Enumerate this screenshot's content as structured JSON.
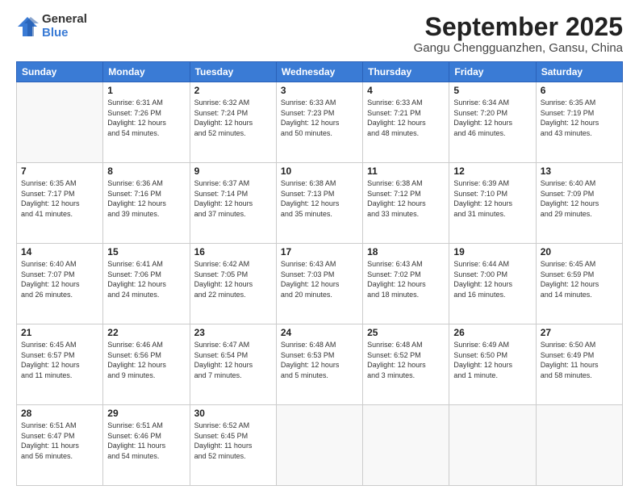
{
  "logo": {
    "general": "General",
    "blue": "Blue"
  },
  "title": "September 2025",
  "location": "Gangu Chengguanzhen, Gansu, China",
  "weekdays": [
    "Sunday",
    "Monday",
    "Tuesday",
    "Wednesday",
    "Thursday",
    "Friday",
    "Saturday"
  ],
  "weeks": [
    [
      {
        "day": "",
        "info": ""
      },
      {
        "day": "1",
        "info": "Sunrise: 6:31 AM\nSunset: 7:26 PM\nDaylight: 12 hours\nand 54 minutes."
      },
      {
        "day": "2",
        "info": "Sunrise: 6:32 AM\nSunset: 7:24 PM\nDaylight: 12 hours\nand 52 minutes."
      },
      {
        "day": "3",
        "info": "Sunrise: 6:33 AM\nSunset: 7:23 PM\nDaylight: 12 hours\nand 50 minutes."
      },
      {
        "day": "4",
        "info": "Sunrise: 6:33 AM\nSunset: 7:21 PM\nDaylight: 12 hours\nand 48 minutes."
      },
      {
        "day": "5",
        "info": "Sunrise: 6:34 AM\nSunset: 7:20 PM\nDaylight: 12 hours\nand 46 minutes."
      },
      {
        "day": "6",
        "info": "Sunrise: 6:35 AM\nSunset: 7:19 PM\nDaylight: 12 hours\nand 43 minutes."
      }
    ],
    [
      {
        "day": "7",
        "info": "Sunrise: 6:35 AM\nSunset: 7:17 PM\nDaylight: 12 hours\nand 41 minutes."
      },
      {
        "day": "8",
        "info": "Sunrise: 6:36 AM\nSunset: 7:16 PM\nDaylight: 12 hours\nand 39 minutes."
      },
      {
        "day": "9",
        "info": "Sunrise: 6:37 AM\nSunset: 7:14 PM\nDaylight: 12 hours\nand 37 minutes."
      },
      {
        "day": "10",
        "info": "Sunrise: 6:38 AM\nSunset: 7:13 PM\nDaylight: 12 hours\nand 35 minutes."
      },
      {
        "day": "11",
        "info": "Sunrise: 6:38 AM\nSunset: 7:12 PM\nDaylight: 12 hours\nand 33 minutes."
      },
      {
        "day": "12",
        "info": "Sunrise: 6:39 AM\nSunset: 7:10 PM\nDaylight: 12 hours\nand 31 minutes."
      },
      {
        "day": "13",
        "info": "Sunrise: 6:40 AM\nSunset: 7:09 PM\nDaylight: 12 hours\nand 29 minutes."
      }
    ],
    [
      {
        "day": "14",
        "info": "Sunrise: 6:40 AM\nSunset: 7:07 PM\nDaylight: 12 hours\nand 26 minutes."
      },
      {
        "day": "15",
        "info": "Sunrise: 6:41 AM\nSunset: 7:06 PM\nDaylight: 12 hours\nand 24 minutes."
      },
      {
        "day": "16",
        "info": "Sunrise: 6:42 AM\nSunset: 7:05 PM\nDaylight: 12 hours\nand 22 minutes."
      },
      {
        "day": "17",
        "info": "Sunrise: 6:43 AM\nSunset: 7:03 PM\nDaylight: 12 hours\nand 20 minutes."
      },
      {
        "day": "18",
        "info": "Sunrise: 6:43 AM\nSunset: 7:02 PM\nDaylight: 12 hours\nand 18 minutes."
      },
      {
        "day": "19",
        "info": "Sunrise: 6:44 AM\nSunset: 7:00 PM\nDaylight: 12 hours\nand 16 minutes."
      },
      {
        "day": "20",
        "info": "Sunrise: 6:45 AM\nSunset: 6:59 PM\nDaylight: 12 hours\nand 14 minutes."
      }
    ],
    [
      {
        "day": "21",
        "info": "Sunrise: 6:45 AM\nSunset: 6:57 PM\nDaylight: 12 hours\nand 11 minutes."
      },
      {
        "day": "22",
        "info": "Sunrise: 6:46 AM\nSunset: 6:56 PM\nDaylight: 12 hours\nand 9 minutes."
      },
      {
        "day": "23",
        "info": "Sunrise: 6:47 AM\nSunset: 6:54 PM\nDaylight: 12 hours\nand 7 minutes."
      },
      {
        "day": "24",
        "info": "Sunrise: 6:48 AM\nSunset: 6:53 PM\nDaylight: 12 hours\nand 5 minutes."
      },
      {
        "day": "25",
        "info": "Sunrise: 6:48 AM\nSunset: 6:52 PM\nDaylight: 12 hours\nand 3 minutes."
      },
      {
        "day": "26",
        "info": "Sunrise: 6:49 AM\nSunset: 6:50 PM\nDaylight: 12 hours\nand 1 minute."
      },
      {
        "day": "27",
        "info": "Sunrise: 6:50 AM\nSunset: 6:49 PM\nDaylight: 11 hours\nand 58 minutes."
      }
    ],
    [
      {
        "day": "28",
        "info": "Sunrise: 6:51 AM\nSunset: 6:47 PM\nDaylight: 11 hours\nand 56 minutes."
      },
      {
        "day": "29",
        "info": "Sunrise: 6:51 AM\nSunset: 6:46 PM\nDaylight: 11 hours\nand 54 minutes."
      },
      {
        "day": "30",
        "info": "Sunrise: 6:52 AM\nSunset: 6:45 PM\nDaylight: 11 hours\nand 52 minutes."
      },
      {
        "day": "",
        "info": ""
      },
      {
        "day": "",
        "info": ""
      },
      {
        "day": "",
        "info": ""
      },
      {
        "day": "",
        "info": ""
      }
    ]
  ]
}
